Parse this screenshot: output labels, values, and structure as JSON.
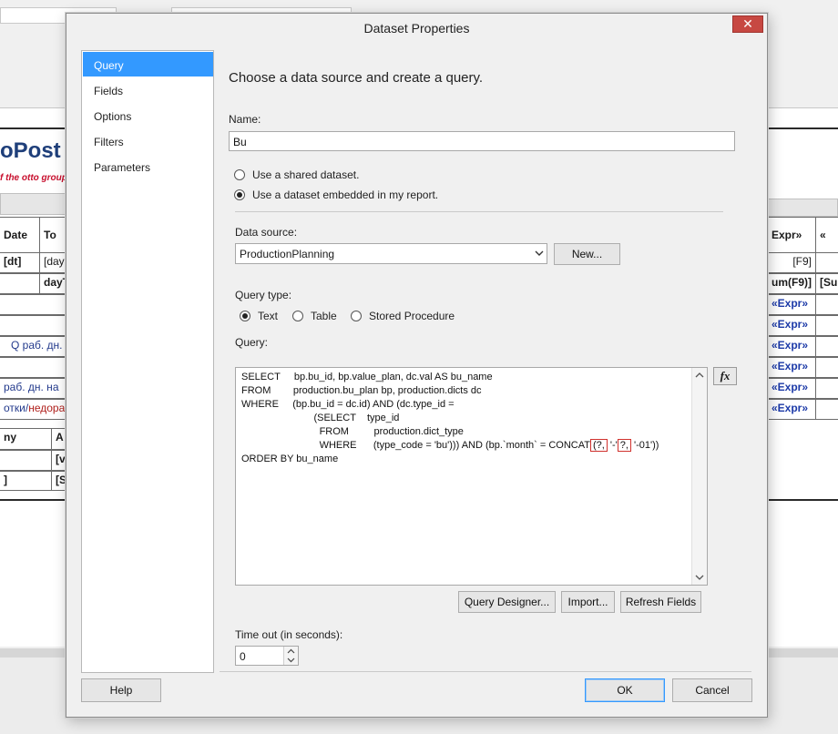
{
  "background": {
    "logo_big": "oPost",
    "logo_small": "f the otto group",
    "cells": {
      "date": "Date",
      "to": "To",
      "dt": "[dt]",
      "day": "[day",
      "dayT": "dayT",
      "q_work": "Q раб. дн.",
      "work_days_on": "раб. дн. на",
      "otki_prefix": "отки/",
      "otki_suffix": "недора",
      "ny": "ny",
      "a": "A",
      "v": "[v",
      "s": "[S",
      "bracket": "]",
      "expr_header": "Expr»",
      "guillemet": "«",
      "f9": "[F9]",
      "um_f9": "um(F9)]",
      "su": "[Su",
      "expr": "«Expr»"
    }
  },
  "dialog": {
    "title": "Dataset Properties",
    "close_glyph": "✕",
    "nav": [
      "Query",
      "Fields",
      "Options",
      "Filters",
      "Parameters"
    ],
    "heading": "Choose a data source and create a query.",
    "name_label": "Name:",
    "name_value": "Bu",
    "radio_shared": "Use a shared dataset.",
    "radio_embedded": "Use a dataset embedded in my report.",
    "data_source_label": "Data source:",
    "data_source_value": "ProductionPlanning",
    "new_button": "New...",
    "query_type_label": "Query type:",
    "query_type_text": "Text",
    "query_type_table": "Table",
    "query_type_sp": "Stored Procedure",
    "query_label": "Query:",
    "query": {
      "l1": "SELECT     bp.bu_id, bp.value_plan, dc.val AS bu_name",
      "l2": "FROM        production.bu_plan bp, production.dicts dc",
      "l3": "WHERE     (bp.bu_id = dc.id) AND (dc.type_id =",
      "l4": "                          (SELECT    type_id",
      "l5": "                            FROM         production.dict_type",
      "l6": "                            WHERE      (type_code = 'bu'))) AND (bp.`month` = CONCAT",
      "p1": "(?,",
      "dash": " '-'",
      "p2": "?,",
      "tail": " '-01'))",
      "l7": "ORDER BY bu_name"
    },
    "fx_label": "fx",
    "query_designer_button": "Query Designer...",
    "import_button": "Import...",
    "refresh_button": "Refresh Fields",
    "timeout_label": "Time out (in seconds):",
    "timeout_value": "0",
    "help_button": "Help",
    "ok_button": "OK",
    "cancel_button": "Cancel"
  }
}
